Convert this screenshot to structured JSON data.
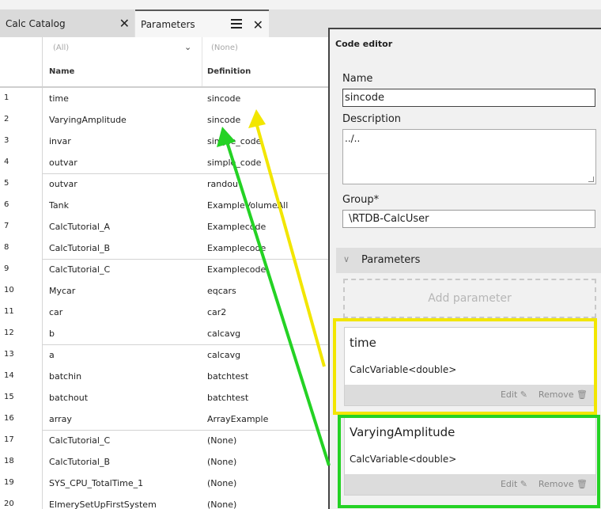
{
  "tabs": [
    {
      "label": "Calc Catalog",
      "close": "✕"
    },
    {
      "label": "Parameters",
      "close": "✕"
    }
  ],
  "table": {
    "filters": {
      "name": "(All)",
      "definition": "(None)"
    },
    "headers": {
      "name": "Name",
      "definition": "Definition"
    },
    "rows": [
      {
        "n": "1",
        "name": "time",
        "def": "sincode"
      },
      {
        "n": "2",
        "name": "VaryingAmplitude",
        "def": "sincode"
      },
      {
        "n": "3",
        "name": "invar",
        "def": "simple_code"
      },
      {
        "n": "4",
        "name": "outvar",
        "def": "simple_code"
      },
      {
        "n": "5",
        "name": "outvar",
        "def": "randou"
      },
      {
        "n": "6",
        "name": "Tank",
        "def": "ExampleVolumeAll"
      },
      {
        "n": "7",
        "name": "CalcTutorial_A",
        "def": "Examplecode"
      },
      {
        "n": "8",
        "name": "CalcTutorial_B",
        "def": "Examplecode"
      },
      {
        "n": "9",
        "name": "CalcTutorial_C",
        "def": "Examplecode"
      },
      {
        "n": "10",
        "name": "Mycar",
        "def": "eqcars"
      },
      {
        "n": "11",
        "name": "car",
        "def": "car2"
      },
      {
        "n": "12",
        "name": "b",
        "def": "calcavg"
      },
      {
        "n": "13",
        "name": "a",
        "def": "calcavg"
      },
      {
        "n": "14",
        "name": "batchin",
        "def": "batchtest"
      },
      {
        "n": "15",
        "name": "batchout",
        "def": "batchtest"
      },
      {
        "n": "16",
        "name": "array",
        "def": "ArrayExample"
      },
      {
        "n": "17",
        "name": "CalcTutorial_C",
        "def": "(None)"
      },
      {
        "n": "18",
        "name": "CalcTutorial_B",
        "def": "(None)"
      },
      {
        "n": "19",
        "name": "SYS_CPU_TotalTime_1",
        "def": "(None)"
      },
      {
        "n": "20",
        "name": "ElmerySetUpFirstSystem",
        "def": "(None)"
      }
    ]
  },
  "editor": {
    "title": "Code editor",
    "name_label": "Name",
    "name_value": "sincode",
    "desc_label": "Description",
    "desc_value": "../..",
    "group_label": "Group*",
    "group_value": "\\RTDB-CalcUser",
    "params_label": "Parameters",
    "add_param": "Add parameter",
    "params": [
      {
        "name": "time",
        "type": "CalcVariable<double>",
        "edit": "Edit ✎",
        "remove": "Remove 🗑"
      },
      {
        "name": "VaryingAmplitude",
        "type": "CalcVariable<double>",
        "edit": "Edit ✎",
        "remove": "Remove 🗑"
      }
    ]
  },
  "colors": {
    "yellow": "#f2e600",
    "green": "#24d224"
  }
}
